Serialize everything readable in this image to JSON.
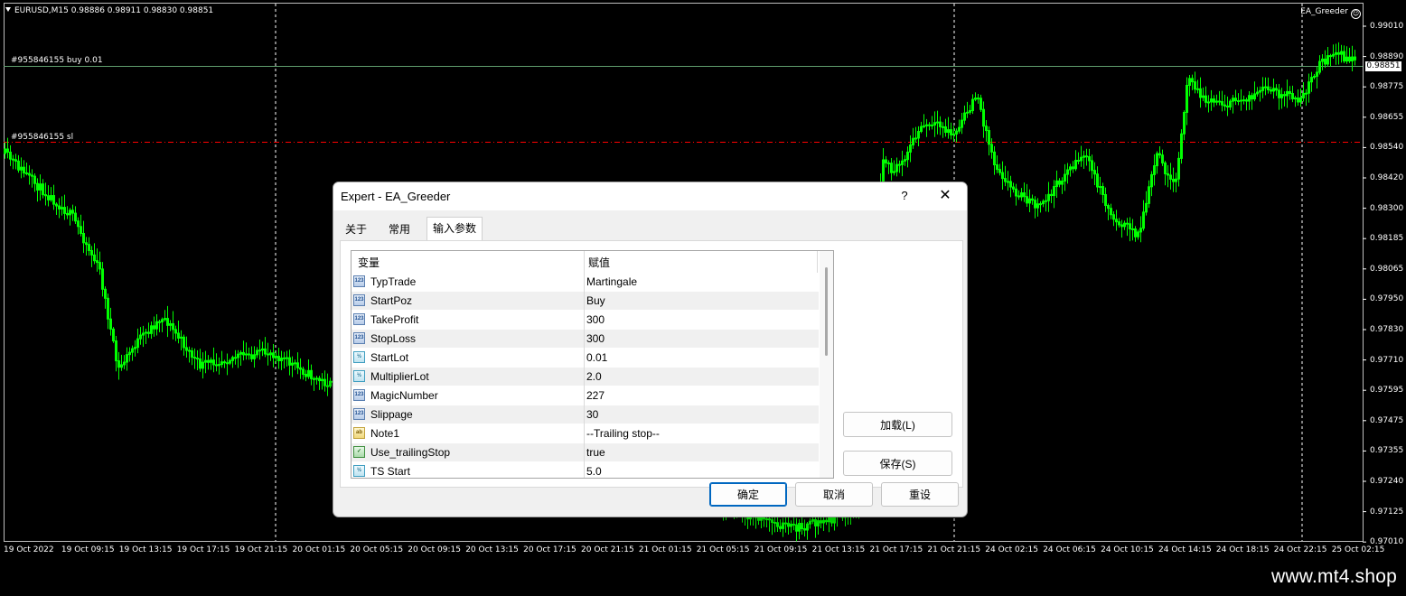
{
  "chart": {
    "symbol_info": "EURUSD,M15  0.98886 0.98911 0.98830 0.98851",
    "ea_name": "EA_Greeder",
    "ea_status_icon": "smiley-icon",
    "current_price": "0.98851",
    "orders": {
      "buy_label": "#955846155 buy 0.01",
      "sl_label": "#955846155 sl"
    },
    "price_axis": [
      "0.99010",
      "0.98890",
      "0.98775",
      "0.98655",
      "0.98540",
      "0.98420",
      "0.98300",
      "0.98185",
      "0.98065",
      "0.97950",
      "0.97830",
      "0.97710",
      "0.97595",
      "0.97475",
      "0.97355",
      "0.97240",
      "0.97125",
      "0.97010"
    ],
    "time_axis": [
      "19 Oct 2022",
      "19 Oct 09:15",
      "19 Oct 13:15",
      "19 Oct 17:15",
      "19 Oct 21:15",
      "20 Oct 01:15",
      "20 Oct 05:15",
      "20 Oct 09:15",
      "20 Oct 13:15",
      "20 Oct 17:15",
      "20 Oct 21:15",
      "21 Oct 01:15",
      "21 Oct 05:15",
      "21 Oct 09:15",
      "21 Oct 13:15",
      "21 Oct 17:15",
      "21 Oct 21:15",
      "24 Oct 02:15",
      "24 Oct 06:15",
      "24 Oct 10:15",
      "24 Oct 14:15",
      "24 Oct 18:15",
      "24 Oct 22:15",
      "25 Oct 02:15"
    ],
    "colors": {
      "background": "#000000",
      "candles": "#00ff00",
      "buy_line": "#5f9e6e",
      "sl_line": "#ff0000",
      "grid": "#ffffff"
    }
  },
  "dialog": {
    "title": "Expert - EA_Greeder",
    "help_label": "?",
    "close_label": "✕",
    "tabs": [
      {
        "label": "关于",
        "active": false
      },
      {
        "label": "常用",
        "active": false
      },
      {
        "label": "输入参数",
        "active": true
      }
    ],
    "grid": {
      "col_variable": "变量",
      "col_value": "赋值",
      "rows": [
        {
          "name": "TypTrade",
          "value": "Martingale",
          "icon": "int-icon"
        },
        {
          "name": "StartPoz",
          "value": "Buy",
          "icon": "int-icon"
        },
        {
          "name": "TakeProfit",
          "value": "300",
          "icon": "int-icon"
        },
        {
          "name": "StopLoss",
          "value": "300",
          "icon": "int-icon"
        },
        {
          "name": "StartLot",
          "value": "0.01",
          "icon": "double-icon"
        },
        {
          "name": "MultiplierLot",
          "value": "2.0",
          "icon": "double-icon"
        },
        {
          "name": "MagicNumber",
          "value": "227",
          "icon": "int-icon"
        },
        {
          "name": "Slippage",
          "value": "30",
          "icon": "int-icon"
        },
        {
          "name": "Note1",
          "value": "--Trailing stop--",
          "icon": "string-icon"
        },
        {
          "name": "Use_trailingStop",
          "value": "true",
          "icon": "bool-icon"
        },
        {
          "name": "TS Start",
          "value": "5.0",
          "icon": "double-icon"
        }
      ]
    },
    "buttons": {
      "load": "加载(L)",
      "save": "保存(S)",
      "ok": "确定",
      "cancel": "取消",
      "reset": "重设"
    }
  },
  "watermark": "www.mt4.shop"
}
